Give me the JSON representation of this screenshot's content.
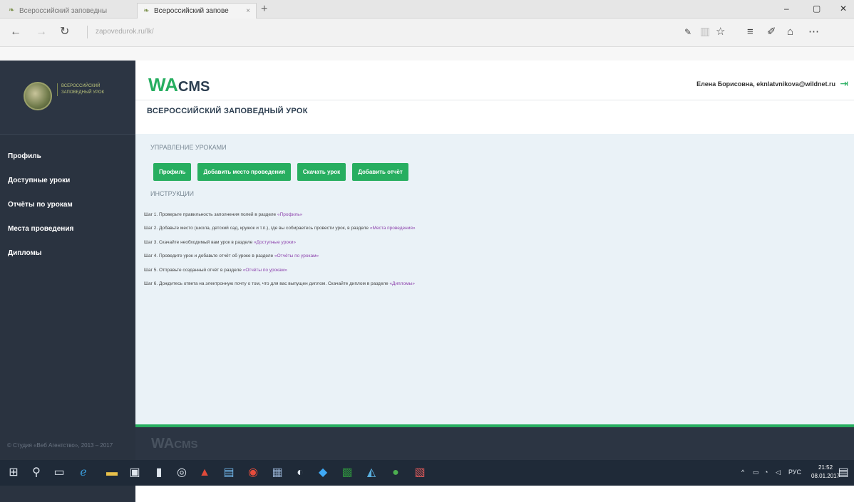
{
  "browser": {
    "tabs": [
      {
        "label": "Всероссийский заповедны",
        "active": false
      },
      {
        "label": "Всероссийский запове",
        "active": true
      }
    ],
    "close_tab": "×",
    "new_tab": "+",
    "url": "zapovedurok.ru/lk/",
    "window": {
      "minimize": "–",
      "maximize": "▢",
      "close": "✕"
    },
    "icons": [
      "back-icon",
      "forward-icon",
      "refresh-icon",
      "reading-view-icon",
      "favorite-star-icon",
      "hub-icon",
      "web-note-icon",
      "share-icon",
      "more-icon"
    ]
  },
  "sidebar": {
    "logo_text": "ВСЕРОССИЙСКИЙ ЗАПОВЕДНЫЙ УРОК",
    "items": [
      {
        "label": "Профиль"
      },
      {
        "label": "Доступные уроки"
      },
      {
        "label": "Отчёты по урокам"
      },
      {
        "label": "Места проведения"
      },
      {
        "label": "Дипломы"
      }
    ],
    "copyright": "© Студия «Веб Агентство», 2013 – 2017"
  },
  "header": {
    "brand_wa": "WA",
    "brand_cms": "CMS",
    "user": "Елена Борисовна, eknlatvnikova@wildnet.ru",
    "site_title": "ВСЕРОССИЙСКИЙ ЗАПОВЕДНЫЙ УРОК"
  },
  "main": {
    "section_title": "УПРАВЛЕНИЕ УРОКАМИ",
    "buttons": [
      "Профиль",
      "Добавить место проведения",
      "Скачать урок",
      "Добавить отчёт"
    ],
    "instructions_title": "ИНСТРУКЦИИ",
    "steps": [
      {
        "text": "Шаг 1. Проверьте правильность заполнения полей в разделе ",
        "link": "«Профиль»",
        "tail": ""
      },
      {
        "text": "Шаг 2. Добавьте место (школа, детский сад, кружок и т.п.), где вы собираетесь провести урок, в разделе ",
        "link": "«Места проведения»",
        "tail": ""
      },
      {
        "text": "Шаг 3. Скачайте необходимый вам урок в разделе ",
        "link": "«Доступные уроки»",
        "tail": ""
      },
      {
        "text": "Шаг 4. Проведите урок и добавьте отчёт об уроке в разделе ",
        "link": "«Отчёты по урокам»",
        "tail": ""
      },
      {
        "text": "Шаг 5. Отправьте созданный отчёт в разделе ",
        "link": "«Отчёты по урокам»",
        "tail": ""
      },
      {
        "text": "Шаг 6. Дождитесь ответа на электронную почту о том, что для вас выпущен диплом. Скачайте диплом в разделе ",
        "link": "«Дипломы»",
        "tail": ""
      }
    ]
  },
  "footer": {
    "brand_wa": "WA",
    "brand_cms": "CMS"
  },
  "taskbar": {
    "language": "РУС",
    "time": "21:52",
    "date": "08.01.2017"
  }
}
